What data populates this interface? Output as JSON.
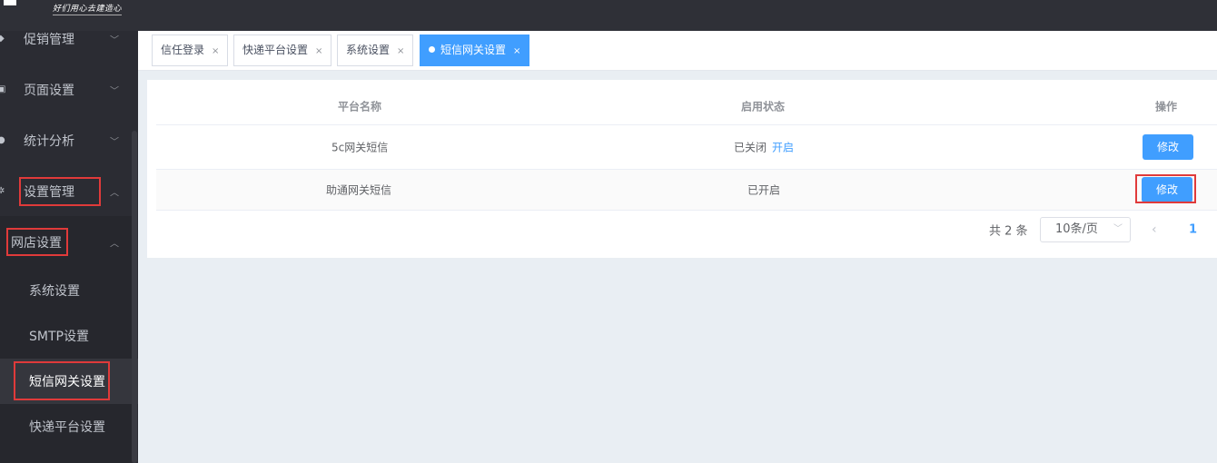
{
  "logo": {
    "tagline": "好们用心去建造心"
  },
  "sidebar": {
    "menu": [
      {
        "label": "促销管理",
        "icon": "tag-icon",
        "arrow": "﹀"
      },
      {
        "label": "页面设置",
        "icon": "page-icon",
        "arrow": "﹀"
      },
      {
        "label": "统计分析",
        "icon": "chart-icon",
        "arrow": "﹀"
      },
      {
        "label": "设置管理",
        "icon": "gear-icon",
        "arrow": "︿"
      }
    ],
    "submenu_group": {
      "label": "网店设置",
      "arrow": "︿"
    },
    "subitems": [
      {
        "label": "系统设置"
      },
      {
        "label": "SMTP设置"
      },
      {
        "label": "短信网关设置"
      },
      {
        "label": "快递平台设置"
      }
    ]
  },
  "tabs": [
    {
      "label": "信任登录",
      "close": "×"
    },
    {
      "label": "快递平台设置",
      "close": "×"
    },
    {
      "label": "系统设置",
      "close": "×"
    },
    {
      "label": "短信网关设置",
      "close": "×"
    }
  ],
  "table": {
    "headers": {
      "name": "平台名称",
      "status": "启用状态",
      "action": "操作"
    },
    "rows": [
      {
        "name": "5c网关短信",
        "status": "已关闭",
        "status_link": "开启",
        "action": "修改"
      },
      {
        "name": "助通网关短信",
        "status": "已开启",
        "status_link": "",
        "action": "修改"
      }
    ]
  },
  "pagination": {
    "total": "共 2 条",
    "page_size": "10条/页",
    "prev": "‹",
    "current_page": "1"
  },
  "colors": {
    "primary": "#409eff",
    "sidebar": "#2b2c33",
    "highlight": "#e03a3a"
  }
}
